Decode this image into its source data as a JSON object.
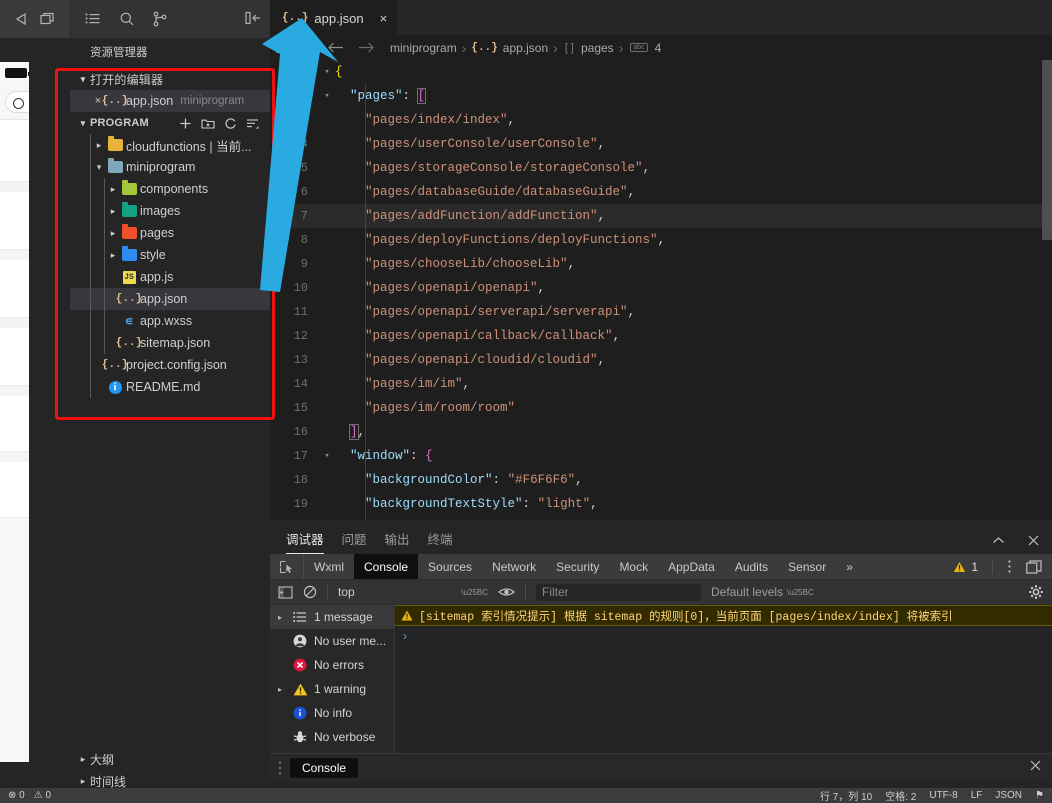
{
  "window": {
    "toolbar_left_icons": [
      "play-icon",
      "simulator-icon"
    ],
    "toolbar_mid_icons": [
      "menu-list-icon",
      "search-icon",
      "source-control-icon"
    ],
    "collapse_icon": "collapse-sidebar-icon",
    "right_icons": [
      "split-editor-icon",
      "more-actions-icon"
    ]
  },
  "sidebar": {
    "title": "资源管理器",
    "open_editors": {
      "label": "打开的编辑器",
      "expanded": true,
      "items": [
        {
          "name": "app.json",
          "desc": "miniprogram",
          "icon": "json-file-icon",
          "selected": true,
          "close": "×"
        }
      ]
    },
    "project": {
      "label": "PROGRAM",
      "expanded": true,
      "actions": [
        "new-file-icon",
        "new-folder-icon",
        "refresh-icon",
        "collapse-all-icon"
      ],
      "items": [
        {
          "name": "cloudfunctions | 当前...",
          "type": "folder",
          "color": "#e8b339",
          "indent": 1,
          "twisty": "right"
        },
        {
          "name": "miniprogram",
          "type": "folder",
          "color": "#7fa8b8",
          "indent": 1,
          "twisty": "down"
        },
        {
          "name": "components",
          "type": "folder",
          "color": "#a4c639",
          "indent": 2,
          "twisty": "right"
        },
        {
          "name": "images",
          "type": "folder",
          "color": "#16a085",
          "indent": 2,
          "twisty": "right"
        },
        {
          "name": "pages",
          "type": "folder",
          "color": "#f0502a",
          "indent": 2,
          "twisty": "right"
        },
        {
          "name": "style",
          "type": "folder",
          "color": "#2d8cf0",
          "indent": 2,
          "twisty": "right"
        },
        {
          "name": "app.js",
          "type": "js",
          "indent": 2,
          "twisty": "none"
        },
        {
          "name": "app.json",
          "type": "json",
          "indent": 2,
          "twisty": "none",
          "selected": true
        },
        {
          "name": "app.wxss",
          "type": "wxss",
          "indent": 2,
          "twisty": "none"
        },
        {
          "name": "sitemap.json",
          "type": "json",
          "indent": 2,
          "twisty": "none"
        },
        {
          "name": "project.config.json",
          "type": "json",
          "indent": 1,
          "twisty": "none"
        },
        {
          "name": "README.md",
          "type": "md",
          "indent": 1,
          "twisty": "none"
        }
      ]
    },
    "bottom_panels": [
      {
        "label": "大纲"
      },
      {
        "label": "时间线"
      }
    ]
  },
  "annotations": {
    "red_box_color": "#ee1111",
    "blue_arrow_color": "#29ABE2"
  },
  "editor": {
    "tabs": [
      {
        "label": "app.json",
        "icon": "json-file-icon",
        "close": "×",
        "active": true
      }
    ],
    "breadcrumb_icons": [
      "outline-list-icon",
      "bookmark-icon",
      "back-arrow-icon",
      "forward-arrow-icon"
    ],
    "breadcrumb": [
      {
        "text": "miniprogram",
        "icon": ""
      },
      {
        "text": "app.json",
        "icon": "json-file-icon"
      },
      {
        "text": "pages",
        "icon": "array-icon"
      },
      {
        "text": "4",
        "icon": "abc-icon"
      }
    ],
    "breadcrumb_separator": "›",
    "lines": [
      {
        "n": 1,
        "fold": "down",
        "html": "<span class='br1'>{</span>",
        "indent": 0
      },
      {
        "n": 2,
        "fold": "down",
        "html": "  <span class='k'>\"pages\"</span><span class='pn'>:</span> <span class='br2 bracket-box'>[</span>",
        "indent": 0
      },
      {
        "n": 3,
        "fold": "",
        "html": "    <span class='p'>\"pages/index/index\"</span><span class='pn'>,</span>",
        "indent": 1
      },
      {
        "n": 4,
        "fold": "",
        "html": "    <span class='p'>\"pages/userConsole/userConsole\"</span><span class='pn'>,</span>",
        "indent": 1
      },
      {
        "n": 5,
        "fold": "",
        "html": "    <span class='p'>\"pages/storageConsole/storageConsole\"</span><span class='pn'>,</span>",
        "indent": 1
      },
      {
        "n": 6,
        "fold": "",
        "html": "    <span class='p'>\"pages/databaseGuide/databaseGuide\"</span><span class='pn'>,</span>",
        "indent": 1
      },
      {
        "n": 7,
        "fold": "",
        "html": "    <span class='p'>\"pages/addFunction/addFunction\"</span><span class='pn'>,</span>",
        "indent": 1,
        "highlight": true
      },
      {
        "n": 8,
        "fold": "",
        "html": "    <span class='p'>\"pages/deployFunctions/deployFunctions\"</span><span class='pn'>,</span>",
        "indent": 1
      },
      {
        "n": 9,
        "fold": "",
        "html": "    <span class='p'>\"pages/chooseLib/chooseLib\"</span><span class='pn'>,</span>",
        "indent": 1
      },
      {
        "n": 10,
        "fold": "",
        "html": "    <span class='p'>\"pages/openapi/openapi\"</span><span class='pn'>,</span>",
        "indent": 1
      },
      {
        "n": 11,
        "fold": "",
        "html": "    <span class='p'>\"pages/openapi/serverapi/serverapi\"</span><span class='pn'>,</span>",
        "indent": 1
      },
      {
        "n": 12,
        "fold": "",
        "html": "    <span class='p'>\"pages/openapi/callback/callback\"</span><span class='pn'>,</span>",
        "indent": 1
      },
      {
        "n": 13,
        "fold": "",
        "html": "    <span class='p'>\"pages/openapi/cloudid/cloudid\"</span><span class='pn'>,</span>",
        "indent": 1
      },
      {
        "n": 14,
        "fold": "",
        "html": "    <span class='p'>\"pages/im/im\"</span><span class='pn'>,</span>",
        "indent": 1
      },
      {
        "n": 15,
        "fold": "",
        "html": "    <span class='p'>\"pages/im/room/room\"</span>",
        "indent": 1
      },
      {
        "n": 16,
        "fold": "",
        "html": "  <span class='br2 bracket-box'>]</span><span class='pn'>,</span>",
        "indent": 0
      },
      {
        "n": 17,
        "fold": "down",
        "html": "  <span class='k'>\"window\"</span><span class='pn'>:</span> <span class='br2'>{</span>",
        "indent": 0
      },
      {
        "n": 18,
        "fold": "",
        "html": "    <span class='k'>\"backgroundColor\"</span><span class='pn'>:</span> <span class='p'>\"#F6F6F6\"</span><span class='pn'>,</span>",
        "indent": 1
      },
      {
        "n": 19,
        "fold": "",
        "html": "    <span class='k'>\"backgroundTextStyle\"</span><span class='pn'>:</span> <span class='p'>\"light\"</span><span class='pn'>,</span>",
        "indent": 1
      }
    ]
  },
  "debugger": {
    "panel_tabs": [
      {
        "label": "调试器",
        "active": true
      },
      {
        "label": "问题",
        "active": false
      },
      {
        "label": "输出",
        "active": false
      },
      {
        "label": "终端",
        "active": false
      }
    ],
    "panel_controls": [
      "chevron-up-icon",
      "close-icon"
    ],
    "devtools_tabs": [
      {
        "label": "Wxml",
        "active": false
      },
      {
        "label": "Console",
        "active": true
      },
      {
        "label": "Sources",
        "active": false
      },
      {
        "label": "Network",
        "active": false
      },
      {
        "label": "Security",
        "active": false
      },
      {
        "label": "Mock",
        "active": false
      },
      {
        "label": "AppData",
        "active": false
      },
      {
        "label": "Audits",
        "active": false
      },
      {
        "label": "Sensor",
        "active": false
      }
    ],
    "devtools_overflow": "»",
    "inspect_icon": "inspect-element-icon",
    "warning_count": "1",
    "right_icons": [
      "more-vertical-icon",
      "dock-side-icon"
    ],
    "console_toolbar": {
      "sidebar_toggle_icon": "console-sidebar-icon",
      "clear_icon": "clear-console-icon",
      "context": "top",
      "eye_icon": "live-expression-icon",
      "filter_placeholder": "Filter",
      "levels": "Default levels",
      "settings_icon": "settings-gear-icon"
    },
    "console_sidebar": [
      {
        "label": "1 message",
        "icon": "list-icon",
        "twisty": true,
        "selected": true
      },
      {
        "label": "No user me...",
        "icon": "user-icon",
        "twisty": false
      },
      {
        "label": "No errors",
        "icon": "error-icon",
        "twisty": false
      },
      {
        "label": "1 warning",
        "icon": "warning-icon",
        "twisty": true
      },
      {
        "label": "No info",
        "icon": "info-icon",
        "twisty": false
      },
      {
        "label": "No verbose",
        "icon": "verbose-bug-icon",
        "twisty": false
      }
    ],
    "console_messages": [
      {
        "level": "warning",
        "icon": "warning-icon",
        "text": "[sitemap 索引情况提示] 根据 sitemap 的规则[0]，当前页面 [pages/index/index] 将被索引"
      }
    ],
    "prompt_symbol": "›",
    "footer_tab": "Console",
    "footer_close": "×",
    "footer_drag_icon": "drag-handle-icon"
  },
  "statusbar": {
    "left": [
      {
        "text": "⊗ 0",
        "name": "errors-indicator"
      },
      {
        "text": "⚠ 0",
        "name": "warnings-indicator"
      }
    ],
    "right": [
      {
        "text": "行 7，列 10",
        "name": "cursor-position"
      },
      {
        "text": "空格: 2",
        "name": "indentation"
      },
      {
        "text": "UTF-8",
        "name": "encoding"
      },
      {
        "text": "LF",
        "name": "eol"
      },
      {
        "text": "JSON",
        "name": "language-mode"
      },
      {
        "text": "⚑",
        "name": "feedback-icon"
      }
    ]
  }
}
